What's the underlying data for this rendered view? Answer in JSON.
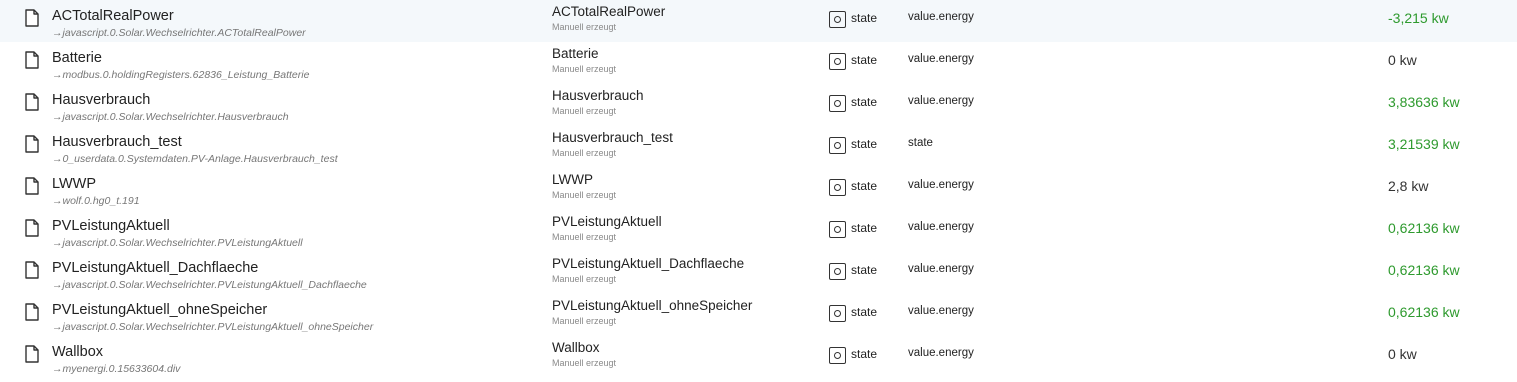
{
  "colors": {
    "value_green": "#2e9a2e",
    "value_neutral": "#333333",
    "alias_gray": "#777777"
  },
  "icons": {
    "object": "file-icon",
    "type": "state-icon"
  },
  "rows": [
    {
      "name": "ACTotalRealPower",
      "alias": "javascript.0.Solar.Wechselrichter.ACTotalRealPower",
      "display_name": "ACTotalRealPower",
      "origin": "Manuell erzeugt",
      "type": "state",
      "role": "value.energy",
      "value": "-3,215 kw",
      "value_color": "green"
    },
    {
      "name": "Batterie",
      "alias": "modbus.0.holdingRegisters.62836_Leistung_Batterie",
      "display_name": "Batterie",
      "origin": "Manuell erzeugt",
      "type": "state",
      "role": "value.energy",
      "value": "0 kw",
      "value_color": "neutral"
    },
    {
      "name": "Hausverbrauch",
      "alias": "javascript.0.Solar.Wechselrichter.Hausverbrauch",
      "display_name": "Hausverbrauch",
      "origin": "Manuell erzeugt",
      "type": "state",
      "role": "value.energy",
      "value": "3,83636 kw",
      "value_color": "green"
    },
    {
      "name": "Hausverbrauch_test",
      "alias": "0_userdata.0.Systemdaten.PV-Anlage.Hausverbrauch_test",
      "display_name": "Hausverbrauch_test",
      "origin": "Manuell erzeugt",
      "type": "state",
      "role": "state",
      "value": "3,21539 kw",
      "value_color": "green"
    },
    {
      "name": "LWWP",
      "alias": "wolf.0.hg0_t.191",
      "display_name": "LWWP",
      "origin": "Manuell erzeugt",
      "type": "state",
      "role": "value.energy",
      "value": "2,8 kw",
      "value_color": "neutral"
    },
    {
      "name": "PVLeistungAktuell",
      "alias": "javascript.0.Solar.Wechselrichter.PVLeistungAktuell",
      "display_name": "PVLeistungAktuell",
      "origin": "Manuell erzeugt",
      "type": "state",
      "role": "value.energy",
      "value": "0,62136 kw",
      "value_color": "green"
    },
    {
      "name": "PVLeistungAktuell_Dachflaeche",
      "alias": "javascript.0.Solar.Wechselrichter.PVLeistungAktuell_Dachflaeche",
      "display_name": "PVLeistungAktuell_Dachflaeche",
      "origin": "Manuell erzeugt",
      "type": "state",
      "role": "value.energy",
      "value": "0,62136 kw",
      "value_color": "green"
    },
    {
      "name": "PVLeistungAktuell_ohneSpeicher",
      "alias": "javascript.0.Solar.Wechselrichter.PVLeistungAktuell_ohneSpeicher",
      "display_name": "PVLeistungAktuell_ohneSpeicher",
      "origin": "Manuell erzeugt",
      "type": "state",
      "role": "value.energy",
      "value": "0,62136 kw",
      "value_color": "green"
    },
    {
      "name": "Wallbox",
      "alias": "myenergi.0.15633604.div",
      "display_name": "Wallbox",
      "origin": "Manuell erzeugt",
      "type": "state",
      "role": "value.energy",
      "value": "0 kw",
      "value_color": "neutral"
    }
  ]
}
